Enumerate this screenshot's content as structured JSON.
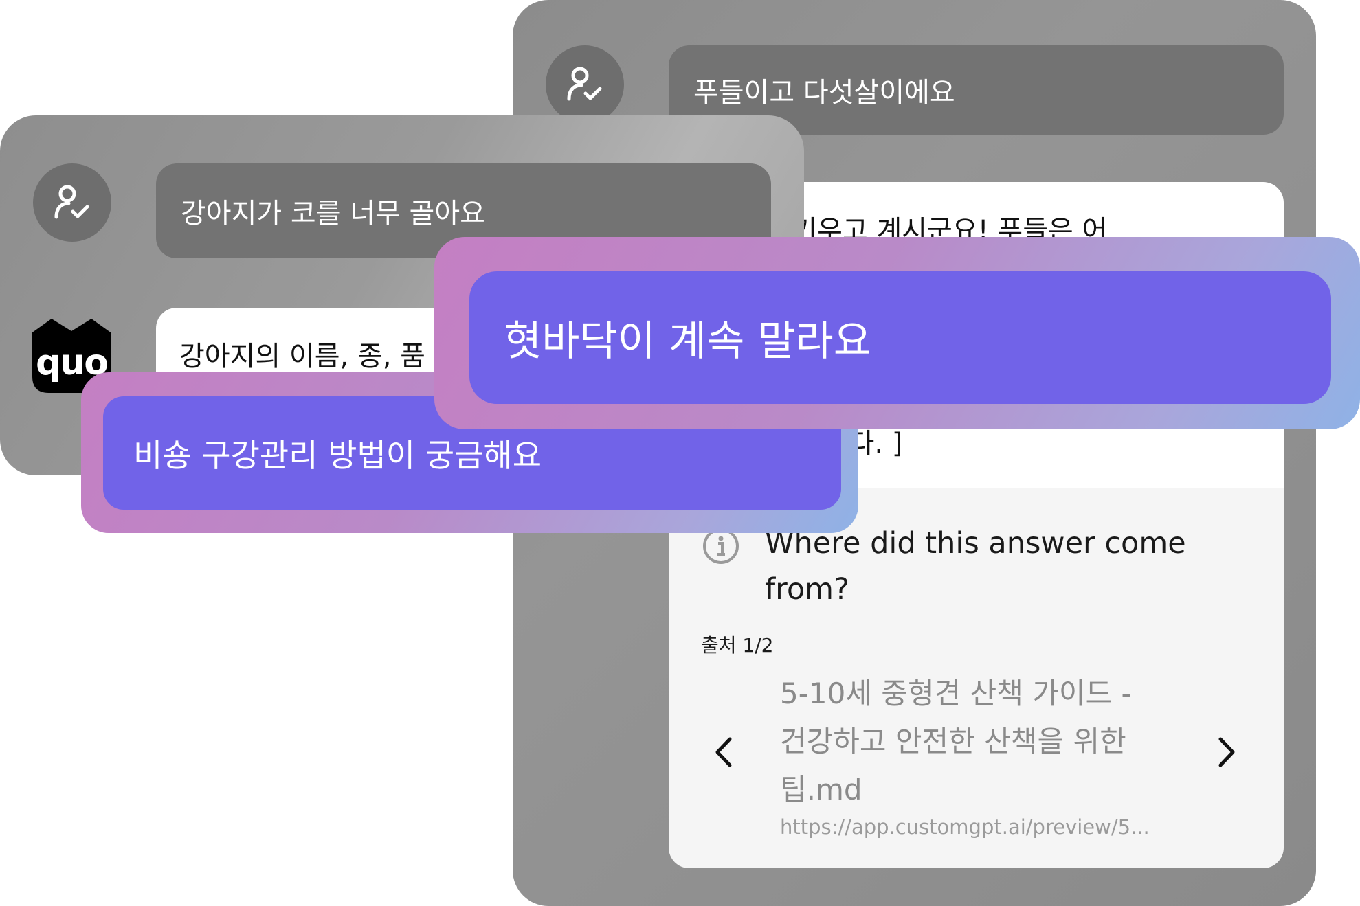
{
  "back_chat": {
    "user_message": "푸들이고 다섯살이에요",
    "bot_partial_top": "요. 푸들을 키우고 계시군요! 푸들은 어",
    "bot_partial_bottom": "하시기 바랍니다. ]",
    "source_question": "Where did this answer come from?",
    "source_question_line1": "Where did this answer come",
    "source_question_line2": "from?",
    "source_counter": "출처 1/2",
    "source_title_line1": "5-10세 중형견 산책 가이드 -",
    "source_title_line2": "건강하고 안전한 산책을 위한",
    "source_title_line3": "팁.md",
    "source_url": "https://app.customgpt.ai/preview/5..."
  },
  "front_chat": {
    "user_message": "강아지가 코를 너무 골아요",
    "bot_partial": "강아지의 이름, 종, 품",
    "bot_logo_text": "quo"
  },
  "suggestions": {
    "large": "혓바닥이 계속 말라요",
    "small": "비숑 구강관리 방법이 궁금해요"
  },
  "icons": {
    "user_check": "user-check-icon",
    "info": "info-icon",
    "prev": "chevron-left-icon",
    "next": "chevron-right-icon"
  }
}
